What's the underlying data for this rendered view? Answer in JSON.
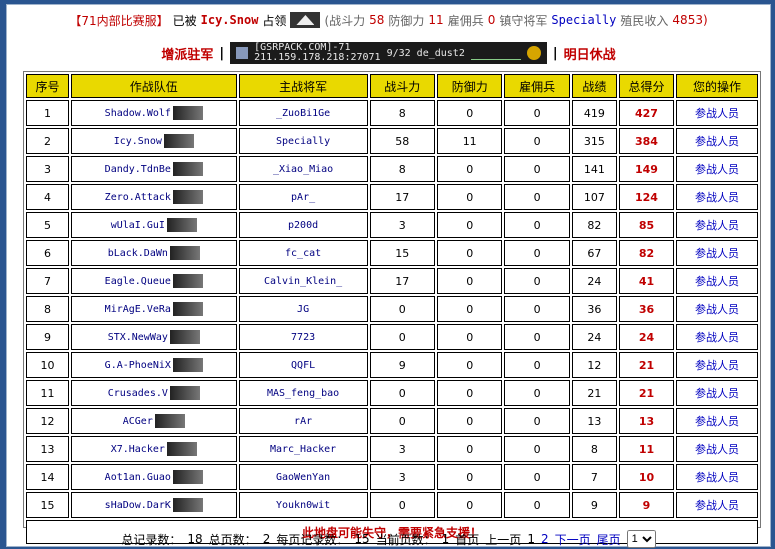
{
  "header": {
    "server_label": "【71内部比赛服】",
    "occupied_text": "已被",
    "occupier": "Icy.Snow",
    "occupied_suffix": "占领",
    "stats": {
      "attack_label": "(战斗力",
      "attack": "58",
      "defense_label": "防御力",
      "defense": "11",
      "merc_label": "雇佣兵",
      "merc": "0",
      "general_label": "镇守将军",
      "general": "Specially",
      "income_label": "殖民收入",
      "income": "4853)"
    }
  },
  "info": {
    "dispatch": "增派驻军",
    "sep": "|",
    "server": {
      "line1": "[GSRPACK.COM]-71",
      "ip": "211.159.178.218:27071",
      "players": "9/32",
      "map": "de_dust2"
    },
    "rest": "明日休战"
  },
  "table": {
    "headers": [
      "序号",
      "作战队伍",
      "主战将军",
      "战斗力",
      "防御力",
      "雇佣兵",
      "战绩",
      "总得分",
      "您的操作"
    ],
    "rows": [
      {
        "no": "1",
        "team": "Shadow.Wolf",
        "general": "_ZuoBi1Ge",
        "atk": "8",
        "def": "0",
        "merc": "0",
        "rec": "419",
        "score": "427",
        "op": "参战人员"
      },
      {
        "no": "2",
        "team": "Icy.Snow",
        "general": "Specially",
        "atk": "58",
        "def": "11",
        "merc": "0",
        "rec": "315",
        "score": "384",
        "op": "参战人员"
      },
      {
        "no": "3",
        "team": "Dandy.TdnBe",
        "general": "_Xiao_Miao",
        "atk": "8",
        "def": "0",
        "merc": "0",
        "rec": "141",
        "score": "149",
        "op": "参战人员"
      },
      {
        "no": "4",
        "team": "Zero.Attack",
        "general": "pAr_",
        "atk": "17",
        "def": "0",
        "merc": "0",
        "rec": "107",
        "score": "124",
        "op": "参战人员"
      },
      {
        "no": "5",
        "team": "wUlaI.GuI",
        "general": "p200d",
        "atk": "3",
        "def": "0",
        "merc": "0",
        "rec": "82",
        "score": "85",
        "op": "参战人员"
      },
      {
        "no": "6",
        "team": "bLack.DaWn",
        "general": "fc_cat",
        "atk": "15",
        "def": "0",
        "merc": "0",
        "rec": "67",
        "score": "82",
        "op": "参战人员"
      },
      {
        "no": "7",
        "team": "Eagle.Queue",
        "general": "Calvin_Klein_",
        "atk": "17",
        "def": "0",
        "merc": "0",
        "rec": "24",
        "score": "41",
        "op": "参战人员"
      },
      {
        "no": "8",
        "team": "MirAgE.VeRa",
        "general": "JG",
        "atk": "0",
        "def": "0",
        "merc": "0",
        "rec": "36",
        "score": "36",
        "op": "参战人员"
      },
      {
        "no": "9",
        "team": "STX.NewWay",
        "general": "7723",
        "atk": "0",
        "def": "0",
        "merc": "0",
        "rec": "24",
        "score": "24",
        "op": "参战人员"
      },
      {
        "no": "10",
        "team": "G.A-PhoeNiX",
        "general": "QQFL",
        "atk": "9",
        "def": "0",
        "merc": "0",
        "rec": "12",
        "score": "21",
        "op": "参战人员"
      },
      {
        "no": "11",
        "team": "Crusades.V",
        "general": "MAS_feng_bao",
        "atk": "0",
        "def": "0",
        "merc": "0",
        "rec": "21",
        "score": "21",
        "op": "参战人员"
      },
      {
        "no": "12",
        "team": "ACGer",
        "general": "rAr",
        "atk": "0",
        "def": "0",
        "merc": "0",
        "rec": "13",
        "score": "13",
        "op": "参战人员"
      },
      {
        "no": "13",
        "team": "X7.Hacker",
        "general": "Marc_Hacker",
        "atk": "3",
        "def": "0",
        "merc": "0",
        "rec": "8",
        "score": "11",
        "op": "参战人员"
      },
      {
        "no": "14",
        "team": "Aot1an.Guao",
        "general": "GaoWenYan",
        "atk": "3",
        "def": "0",
        "merc": "0",
        "rec": "7",
        "score": "10",
        "op": "参战人员"
      },
      {
        "no": "15",
        "team": "sHaDow.DarK",
        "general": "Youkn0wit",
        "atk": "0",
        "def": "0",
        "merc": "0",
        "rec": "9",
        "score": "9",
        "op": "参战人员"
      }
    ],
    "warning": "此地盘可能失守，需要紧急支援！"
  },
  "footer": {
    "total_records_label": "总记录数：",
    "total_records": "18",
    "total_pages_label": "总页数：",
    "total_pages": "2",
    "per_page_label": "每页记录数：",
    "per_page": "15",
    "current_page_label": "当前页数：",
    "current_page": "1",
    "first": "首页",
    "prev": "上一页",
    "page1": "1",
    "page2": "2",
    "next": "下一页",
    "last": "尾页",
    "select_value": "1"
  }
}
